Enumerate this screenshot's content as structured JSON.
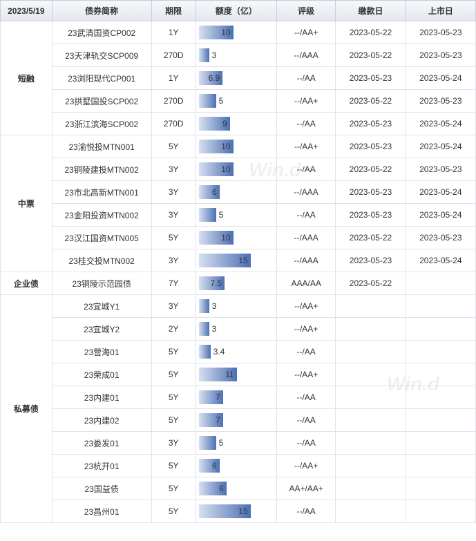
{
  "headers": {
    "date": "2023/5/19",
    "name": "债券简称",
    "term": "期限",
    "amount": "额度（亿）",
    "rating": "评级",
    "pay_date": "缴款日",
    "list_date": "上市日"
  },
  "groups": [
    {
      "category": "短融",
      "rows": [
        {
          "name": "23武清国资CP002",
          "term": "1Y",
          "amount": 10,
          "rating": "--/AA+",
          "pay": "2023-05-22",
          "list": "2023-05-23"
        },
        {
          "name": "23天津轨交SCP009",
          "term": "270D",
          "amount": 3,
          "rating": "--/AAA",
          "pay": "2023-05-22",
          "list": "2023-05-23"
        },
        {
          "name": "23浏阳现代CP001",
          "term": "1Y",
          "amount": 6.9,
          "rating": "--/AA",
          "pay": "2023-05-23",
          "list": "2023-05-24"
        },
        {
          "name": "23拱墅国投SCP002",
          "term": "270D",
          "amount": 5,
          "rating": "--/AA+",
          "pay": "2023-05-22",
          "list": "2023-05-23"
        },
        {
          "name": "23浙江滨海SCP002",
          "term": "270D",
          "amount": 9,
          "rating": "--/AA",
          "pay": "2023-05-23",
          "list": "2023-05-24"
        }
      ]
    },
    {
      "category": "中票",
      "rows": [
        {
          "name": "23渝悦投MTN001",
          "term": "5Y",
          "amount": 10,
          "rating": "--/AA+",
          "pay": "2023-05-23",
          "list": "2023-05-24"
        },
        {
          "name": "23铜陵建投MTN002",
          "term": "3Y",
          "amount": 10,
          "rating": "--/AA",
          "pay": "2023-05-22",
          "list": "2023-05-23"
        },
        {
          "name": "23市北高新MTN001",
          "term": "3Y",
          "amount": 6,
          "rating": "--/AAA",
          "pay": "2023-05-23",
          "list": "2023-05-24"
        },
        {
          "name": "23金阳投资MTN002",
          "term": "3Y",
          "amount": 5,
          "rating": "--/AA",
          "pay": "2023-05-23",
          "list": "2023-05-24"
        },
        {
          "name": "23汉江国资MTN005",
          "term": "5Y",
          "amount": 10,
          "rating": "--/AAA",
          "pay": "2023-05-22",
          "list": "2023-05-23"
        },
        {
          "name": "23桂交投MTN002",
          "term": "3Y",
          "amount": 15,
          "rating": "--/AAA",
          "pay": "2023-05-23",
          "list": "2023-05-24"
        }
      ]
    },
    {
      "category": "企业债",
      "rows": [
        {
          "name": "23铜陵示范园债",
          "term": "7Y",
          "amount": 7.5,
          "rating": "AAA/AA",
          "pay": "2023-05-22",
          "list": ""
        }
      ]
    },
    {
      "category": "私募债",
      "rows": [
        {
          "name": "23宜城Y1",
          "term": "3Y",
          "amount": 3,
          "rating": "--/AA+",
          "pay": "",
          "list": ""
        },
        {
          "name": "23宜城Y2",
          "term": "2Y",
          "amount": 3,
          "rating": "--/AA+",
          "pay": "",
          "list": ""
        },
        {
          "name": "23营海01",
          "term": "5Y",
          "amount": 3.4,
          "rating": "--/AA",
          "pay": "",
          "list": ""
        },
        {
          "name": "23荣成01",
          "term": "5Y",
          "amount": 11,
          "rating": "--/AA+",
          "pay": "",
          "list": ""
        },
        {
          "name": "23内建01",
          "term": "5Y",
          "amount": 7,
          "rating": "--/AA",
          "pay": "",
          "list": ""
        },
        {
          "name": "23内建02",
          "term": "5Y",
          "amount": 7,
          "rating": "--/AA",
          "pay": "",
          "list": ""
        },
        {
          "name": "23娄发01",
          "term": "3Y",
          "amount": 5,
          "rating": "--/AA",
          "pay": "",
          "list": ""
        },
        {
          "name": "23杭开01",
          "term": "5Y",
          "amount": 6,
          "rating": "--/AA+",
          "pay": "",
          "list": ""
        },
        {
          "name": "23国益债",
          "term": "5Y",
          "amount": 8,
          "rating": "AA+/AA+",
          "pay": "",
          "list": ""
        },
        {
          "name": "23昌州01",
          "term": "5Y",
          "amount": 15,
          "rating": "--/AA",
          "pay": "",
          "list": ""
        }
      ]
    }
  ],
  "chart_data": {
    "type": "bar",
    "title": "",
    "xlabel": "额度（亿）",
    "ylabel": "债券简称",
    "xlim": [
      0,
      20
    ],
    "categories": [
      "23武清国资CP002",
      "23天津轨交SCP009",
      "23浏阳现代CP001",
      "23拱墅国投SCP002",
      "23浙江滨海SCP002",
      "23渝悦投MTN001",
      "23铜陵建投MTN002",
      "23市北高新MTN001",
      "23金阳投资MTN002",
      "23汉江国资MTN005",
      "23桂交投MTN002",
      "23铜陵示范园债",
      "23宜城Y1",
      "23宜城Y2",
      "23营海01",
      "23荣成01",
      "23内建01",
      "23内建02",
      "23娄发01",
      "23杭开01",
      "23国益债",
      "23昌州01"
    ],
    "values": [
      10,
      3,
      6.9,
      5,
      9,
      10,
      10,
      6,
      5,
      10,
      15,
      7.5,
      3,
      3,
      3.4,
      11,
      7,
      7,
      5,
      6,
      8,
      15
    ]
  },
  "watermark": "Win.d"
}
